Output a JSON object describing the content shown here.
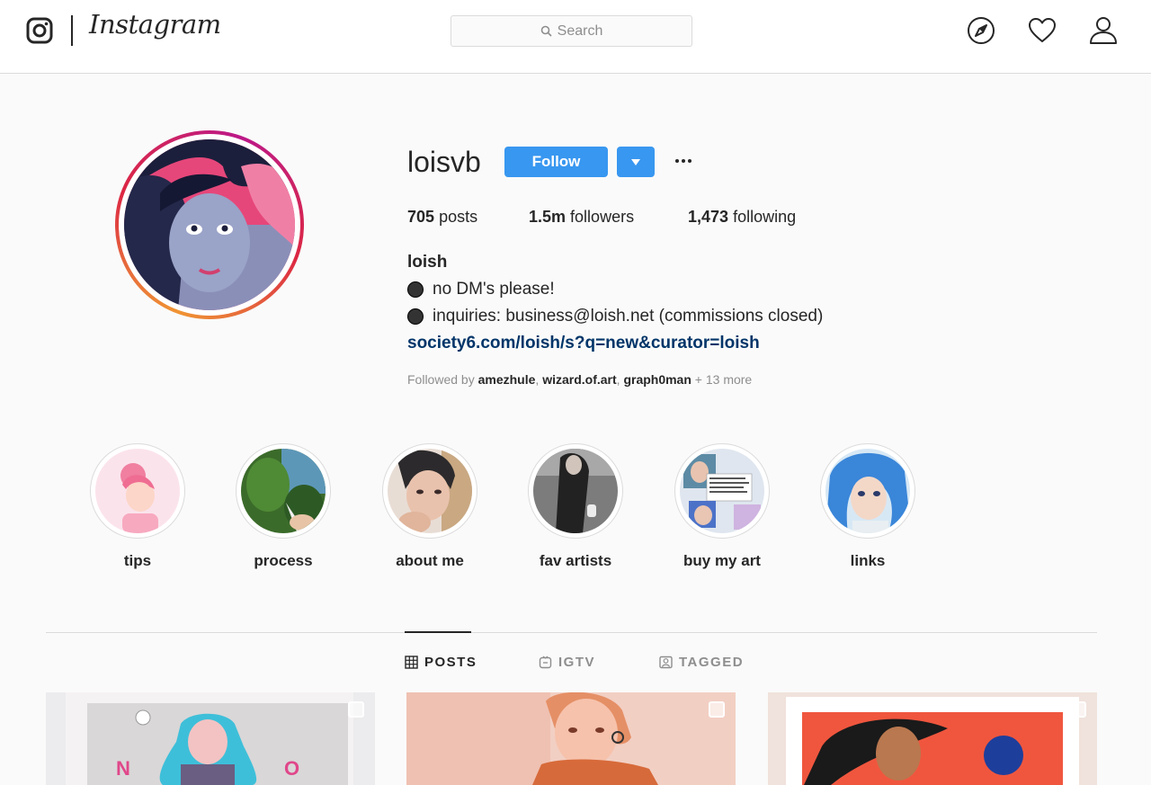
{
  "header": {
    "wordmark": "Instagram",
    "search_placeholder": "Search",
    "icons": [
      "instagram-logo-icon",
      "search-icon",
      "compass-icon",
      "heart-icon",
      "profile-icon"
    ]
  },
  "profile": {
    "username": "loisvb",
    "follow_label": "Follow",
    "stats": {
      "posts_count": "705",
      "posts_label": "posts",
      "followers_count": "1.5m",
      "followers_label": "followers",
      "following_count": "1,473",
      "following_label": "following"
    },
    "bio": {
      "name": "loish",
      "line1": "no DM's please!",
      "line2": "inquiries: business@loish.net (commissions closed)",
      "link": "society6.com/loish/s?q=new&curator=loish"
    },
    "followed_by": {
      "prefix": "Followed by",
      "names": [
        "amezhule",
        "wizard.of.art",
        "graph0man"
      ],
      "separator": ",",
      "more": "+ 13 more"
    }
  },
  "highlights": [
    {
      "label": "tips"
    },
    {
      "label": "process"
    },
    {
      "label": "about me"
    },
    {
      "label": "fav artists"
    },
    {
      "label": "buy my art"
    },
    {
      "label": "links"
    }
  ],
  "tabs": [
    {
      "label": "POSTS",
      "active": true
    },
    {
      "label": "IGTV",
      "active": false
    },
    {
      "label": "TAGGED",
      "active": false
    }
  ],
  "colors": {
    "accent": "#3897f0",
    "link": "#003569",
    "muted": "#8e8e8e",
    "border": "#dbdbdb"
  }
}
